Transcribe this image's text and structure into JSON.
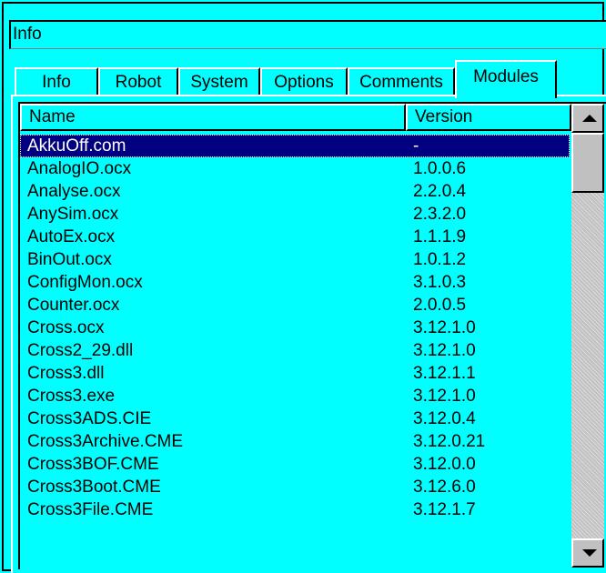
{
  "window": {
    "title": "Info"
  },
  "tabs": [
    {
      "label": "Info"
    },
    {
      "label": "Robot"
    },
    {
      "label": "System"
    },
    {
      "label": "Options"
    },
    {
      "label": "Comments"
    },
    {
      "label": "Modules",
      "active": true
    }
  ],
  "list": {
    "columns": {
      "name": "Name",
      "version": "Version"
    },
    "rows": [
      {
        "name": "AkkuOff.com",
        "version": "-",
        "selected": true
      },
      {
        "name": "AnalogIO.ocx",
        "version": "1.0.0.6"
      },
      {
        "name": "Analyse.ocx",
        "version": "2.2.0.4"
      },
      {
        "name": "AnySim.ocx",
        "version": "2.3.2.0"
      },
      {
        "name": "AutoEx.ocx",
        "version": "1.1.1.9"
      },
      {
        "name": "BinOut.ocx",
        "version": "1.0.1.2"
      },
      {
        "name": "ConfigMon.ocx",
        "version": "3.1.0.3"
      },
      {
        "name": "Counter.ocx",
        "version": "2.0.0.5"
      },
      {
        "name": "Cross.ocx",
        "version": "3.12.1.0"
      },
      {
        "name": "Cross2_29.dll",
        "version": "3.12.1.0"
      },
      {
        "name": "Cross3.dll",
        "version": "3.12.1.1"
      },
      {
        "name": "Cross3.exe",
        "version": "3.12.1.0"
      },
      {
        "name": "Cross3ADS.CIE",
        "version": "3.12.0.4"
      },
      {
        "name": "Cross3Archive.CME",
        "version": "3.12.0.21"
      },
      {
        "name": "Cross3BOF.CME",
        "version": "3.12.0.0"
      },
      {
        "name": "Cross3Boot.CME",
        "version": "3.12.6.0"
      },
      {
        "name": "Cross3File.CME",
        "version": "3.12.1.7"
      }
    ]
  },
  "icons": {
    "scroll_up": "arrow-up-icon",
    "scroll_down": "arrow-down-icon"
  },
  "colors": {
    "background": "#00ffff",
    "selection": "#000080"
  }
}
